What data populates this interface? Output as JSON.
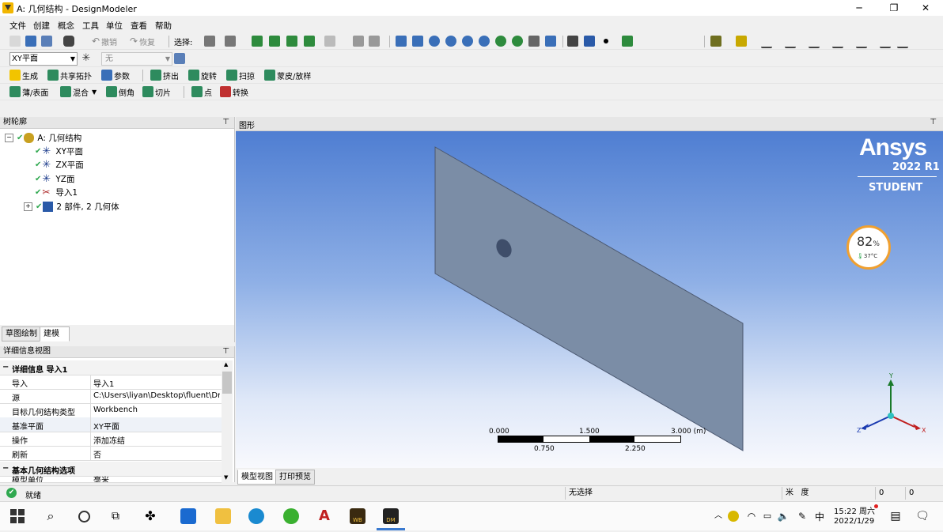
{
  "window": {
    "title": "A: 几何结构 - DesignModeler",
    "minimize": "─",
    "restore": "❐",
    "close": "✕"
  },
  "menu": [
    "文件",
    "创建",
    "概念",
    "工具",
    "单位",
    "查看",
    "帮助"
  ],
  "toolbar1": {
    "undo": "撤销",
    "redo": "恢复",
    "select_label": "选择:"
  },
  "toolbar2": {
    "plane_select": "XY平面",
    "sketch_select": "无"
  },
  "toolbar3": {
    "generate": "生成",
    "share_topology": "共享拓扑",
    "parameters": "参数",
    "extrude": "挤出",
    "revolve": "旋转",
    "sweep": "扫掠",
    "skin_loft": "蒙皮/放样"
  },
  "toolbar4": {
    "thin_surface": "薄/表面",
    "blend": "混合",
    "chamfer": "倒角",
    "slice": "切片",
    "point": "点",
    "conversion": "转换"
  },
  "tree": {
    "header": "树轮廓",
    "pin": "⇕",
    "items": [
      "A: 几何结构",
      "XY平面",
      "ZX平面",
      "YZ面",
      "导入1",
      "2 部件, 2 几何体"
    ]
  },
  "left_tabs": [
    "草图绘制",
    "建模"
  ],
  "details": {
    "header": "详细信息视图",
    "section1": "详细信息 导入1",
    "rows": [
      {
        "key": "导入",
        "value": "导入1"
      },
      {
        "key": "源",
        "value": "C:\\Users\\liyan\\Desktop\\fluent\\Dr..."
      },
      {
        "key": "目标几何结构类型",
        "value": "Workbench"
      },
      {
        "key": "基准平面",
        "value": "XY平面"
      },
      {
        "key": "操作",
        "value": "添加冻结"
      },
      {
        "key": "刷新",
        "value": "否"
      }
    ],
    "section2": "基本几何结构选项",
    "partial_row": {
      "key": "模型单位",
      "value": "毫米"
    }
  },
  "graphics": {
    "header": "图形",
    "brand": "Ansys",
    "version": "2022 R1",
    "edition": "STUDENT",
    "perf_value": "82",
    "perf_unit": "%",
    "perf_temp": "37°C",
    "scale_top": [
      "0.000",
      "1.500",
      "3.000 (m)"
    ],
    "scale_bottom": [
      "0.750",
      "2.250"
    ],
    "axes": {
      "y": "Y",
      "z": "Z",
      "x": "X"
    }
  },
  "bottom_tabs": [
    "模型视图",
    "打印预览"
  ],
  "status": {
    "ready": "就绪",
    "selection": "无选择",
    "units1": "米",
    "units2": "度",
    "v1": "0",
    "v2": "0"
  },
  "taskbar": {
    "ime": "中",
    "time": "15:22 周六",
    "date": "2022/1/29",
    "wb_label": "WB",
    "dm_label": "DM",
    "acad_label": "A"
  },
  "colors": {
    "accent": "#1f6fd0",
    "viewport_top": "#4f7ed2",
    "perf_ring": "#f0a030",
    "status_ok": "#2fa84f"
  }
}
